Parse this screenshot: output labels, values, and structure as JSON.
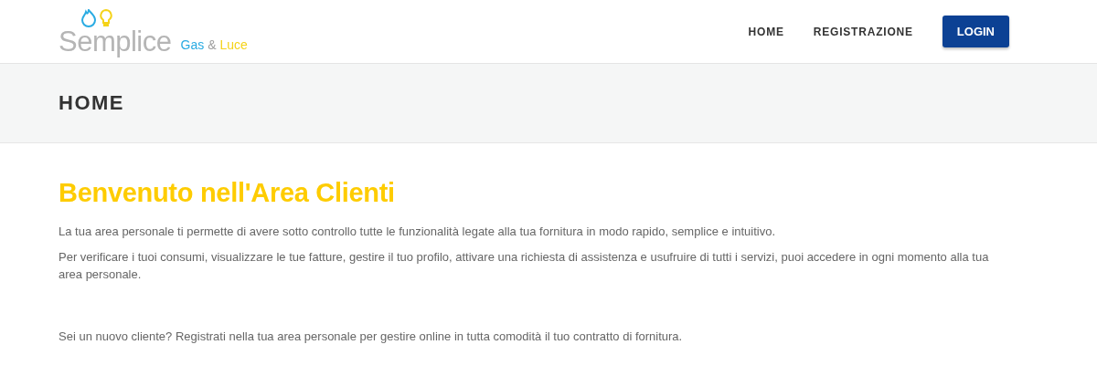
{
  "logo": {
    "name": "Semplice",
    "parts": [
      {
        "text": "Gas",
        "color": "#29abe2"
      },
      {
        "text": "&",
        "color": "#a0a0a0"
      },
      {
        "text": "Luce",
        "color": "#f5d31a"
      }
    ]
  },
  "nav": [
    {
      "label": "HOME",
      "kind": "link"
    },
    {
      "label": "REGISTRAZIONE",
      "kind": "link"
    },
    {
      "label": "LOGIN",
      "kind": "button"
    }
  ],
  "page_title": "HOME",
  "content": {
    "heading": "Benvenuto nell'Area Clienti",
    "paragraphs": [
      "La tua area personale ti permette di avere sotto controllo tutte le funzionalità legate alla tua fornitura in modo rapido, semplice e intuitivo.",
      "Per verificare i tuoi consumi, visualizzare le tue fatture, gestire il tuo profilo, attivare una richiesta di assistenza e usufruire di tutti i servizi, puoi accedere in ogni momento alla tua area personale.",
      "Sei un nuovo cliente? Registrati nella tua area personale per gestire online in tutta comodità il tuo contratto di fornitura."
    ]
  }
}
